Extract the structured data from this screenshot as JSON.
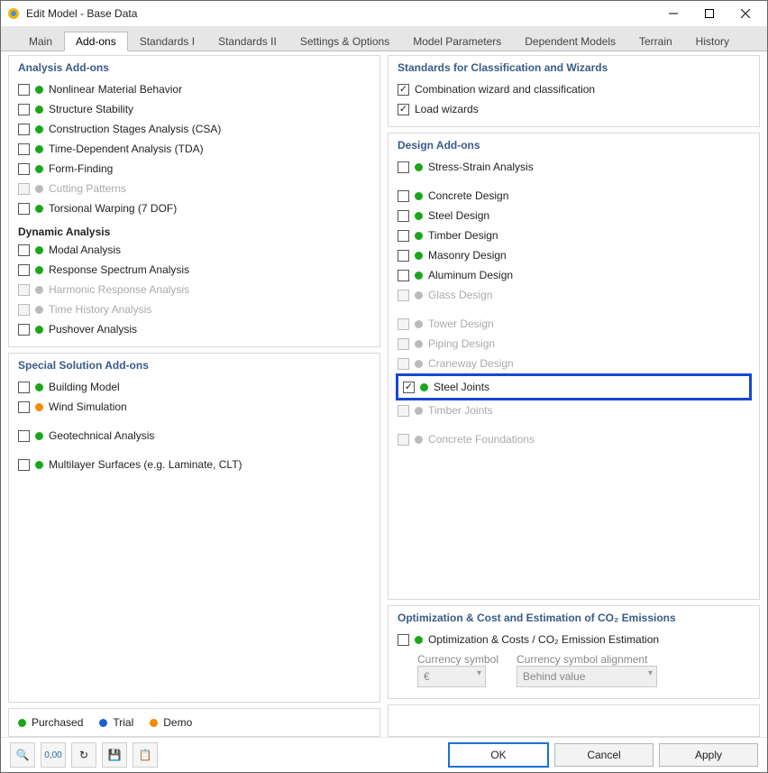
{
  "window": {
    "title": "Edit Model - Base Data"
  },
  "tabs": [
    "Main",
    "Add-ons",
    "Standards I",
    "Standards II",
    "Settings & Options",
    "Model Parameters",
    "Dependent Models",
    "Terrain",
    "History"
  ],
  "active_tab": "Add-ons",
  "sections": {
    "analysis_title": "Analysis Add-ons",
    "dynamic_title": "Dynamic Analysis",
    "special_title": "Special Solution Add-ons",
    "standards_title": "Standards for Classification and Wizards",
    "design_title": "Design Add-ons",
    "optimization_title": "Optimization & Cost and Estimation of CO₂ Emissions"
  },
  "analysis": [
    {
      "label": "Nonlinear Material Behavior",
      "status": "green",
      "checked": false,
      "disabled": false
    },
    {
      "label": "Structure Stability",
      "status": "green",
      "checked": false,
      "disabled": false
    },
    {
      "label": "Construction Stages Analysis (CSA)",
      "status": "green",
      "checked": false,
      "disabled": false
    },
    {
      "label": "Time-Dependent Analysis (TDA)",
      "status": "green",
      "checked": false,
      "disabled": false
    },
    {
      "label": "Form-Finding",
      "status": "green",
      "checked": false,
      "disabled": false
    },
    {
      "label": "Cutting Patterns",
      "status": "grey",
      "checked": false,
      "disabled": true
    },
    {
      "label": "Torsional Warping (7 DOF)",
      "status": "green",
      "checked": false,
      "disabled": false
    }
  ],
  "dynamic": [
    {
      "label": "Modal Analysis",
      "status": "green",
      "checked": false,
      "disabled": false
    },
    {
      "label": "Response Spectrum Analysis",
      "status": "green",
      "checked": false,
      "disabled": false
    },
    {
      "label": "Harmonic Response Analysis",
      "status": "grey",
      "checked": false,
      "disabled": true
    },
    {
      "label": "Time History Analysis",
      "status": "grey",
      "checked": false,
      "disabled": true
    },
    {
      "label": "Pushover Analysis",
      "status": "green",
      "checked": false,
      "disabled": false
    }
  ],
  "special": [
    {
      "label": "Building Model",
      "status": "green",
      "checked": false,
      "disabled": false
    },
    {
      "label": "Wind Simulation",
      "status": "orange",
      "checked": false,
      "disabled": false
    },
    {
      "label": "Geotechnical Analysis",
      "status": "green",
      "checked": false,
      "disabled": false,
      "gap": true
    },
    {
      "label": "Multilayer Surfaces (e.g. Laminate, CLT)",
      "status": "green",
      "checked": false,
      "disabled": false,
      "gap": true
    }
  ],
  "standards": [
    {
      "label": "Combination wizard and classification",
      "checked": true
    },
    {
      "label": "Load wizards",
      "checked": true
    }
  ],
  "design": [
    {
      "label": "Stress-Strain Analysis",
      "status": "green",
      "checked": false,
      "disabled": false
    },
    {
      "label": "Concrete Design",
      "status": "green",
      "checked": false,
      "disabled": false,
      "gap": true
    },
    {
      "label": "Steel Design",
      "status": "green",
      "checked": false,
      "disabled": false
    },
    {
      "label": "Timber Design",
      "status": "green",
      "checked": false,
      "disabled": false
    },
    {
      "label": "Masonry Design",
      "status": "green",
      "checked": false,
      "disabled": false
    },
    {
      "label": "Aluminum Design",
      "status": "green",
      "checked": false,
      "disabled": false
    },
    {
      "label": "Glass Design",
      "status": "grey",
      "checked": false,
      "disabled": true
    },
    {
      "label": "Tower Design",
      "status": "grey",
      "checked": false,
      "disabled": true,
      "gap": true
    },
    {
      "label": "Piping Design",
      "status": "grey",
      "checked": false,
      "disabled": true
    },
    {
      "label": "Craneway Design",
      "status": "grey",
      "checked": false,
      "disabled": true
    },
    {
      "label": "Steel Joints",
      "status": "green",
      "checked": true,
      "disabled": false,
      "highlight": true,
      "gap": true
    },
    {
      "label": "Timber Joints",
      "status": "grey",
      "checked": false,
      "disabled": true
    },
    {
      "label": "Concrete Foundations",
      "status": "grey",
      "checked": false,
      "disabled": true,
      "gap": true
    }
  ],
  "optimization": {
    "item": {
      "label": "Optimization & Costs / CO₂ Emission Estimation",
      "status": "green",
      "checked": false,
      "disabled": false
    },
    "currency_label": "Currency symbol",
    "currency_value": "€",
    "alignment_label": "Currency symbol alignment",
    "alignment_value": "Behind value"
  },
  "legend": {
    "purchased": "Purchased",
    "trial": "Trial",
    "demo": "Demo"
  },
  "footer": {
    "ok": "OK",
    "cancel": "Cancel",
    "apply": "Apply"
  }
}
